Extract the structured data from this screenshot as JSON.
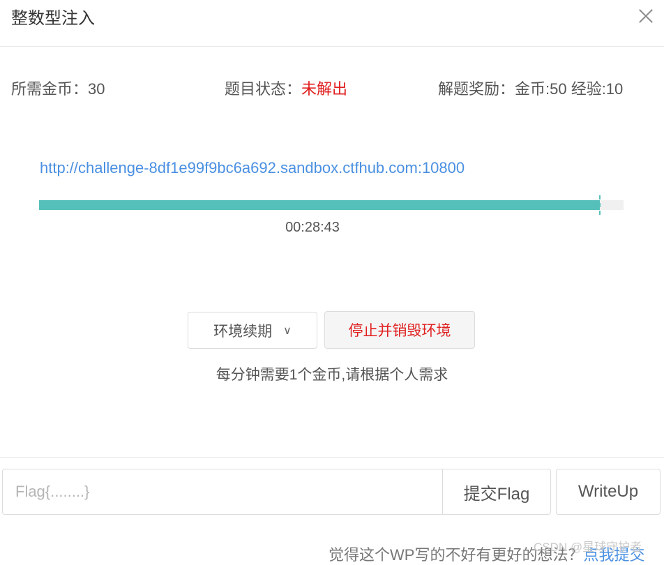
{
  "dialog": {
    "title": "整数型注入",
    "close_label": "×"
  },
  "info": {
    "cost_label": "所需金币：30",
    "status_label": "题目状态：",
    "status_value": "未解出",
    "reward_label": "解题奖励：金币:50 经验:10"
  },
  "environment": {
    "url": "http://challenge-8df1e99f9bc6a692.sandbox.ctfhub.com:10800",
    "time_remaining": "00:28:43",
    "progress_fraction": 0.96,
    "renew_label": "环境续期",
    "renew_chevron": "∨",
    "stop_label": "停止并销毁环境",
    "note": "每分钟需要1个金币,请根据个人需求"
  },
  "flag": {
    "placeholder": "Flag{........}",
    "value": "",
    "submit_label": "提交Flag",
    "writeup_label": "WriteUp"
  },
  "footer": {
    "prompt": "觉得这个WP写的不好有更好的想法？",
    "link": "点我提交"
  },
  "watermark": "CSDN @星球守护者",
  "colors": {
    "accent_teal": "#55c0b9",
    "link_blue": "#4a90e2",
    "status_red": "#e02020"
  },
  "icons": {
    "close": "close-icon",
    "dropdown": "chevron-down-icon"
  }
}
